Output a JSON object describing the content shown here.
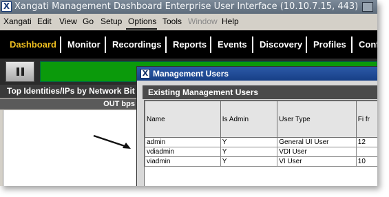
{
  "window": {
    "title": "Xangati Management Dashboard Enterprise User Interface (10.10.7.15, 443)",
    "app_icon": "X"
  },
  "menu": {
    "items": [
      {
        "label": "Xangati",
        "enabled": true
      },
      {
        "label": "Edit",
        "enabled": true
      },
      {
        "label": "View",
        "enabled": true
      },
      {
        "label": "Go",
        "enabled": true
      },
      {
        "label": "Setup",
        "enabled": true
      },
      {
        "label": "Options",
        "enabled": true,
        "highlighted": true
      },
      {
        "label": "Tools",
        "enabled": true
      },
      {
        "label": "Window",
        "enabled": false
      },
      {
        "label": "Help",
        "enabled": true
      }
    ]
  },
  "nav": {
    "tabs": [
      {
        "label": "Dashboard",
        "active": true
      },
      {
        "label": "Monitor"
      },
      {
        "label": "Recordings"
      },
      {
        "label": "Reports"
      },
      {
        "label": "Events"
      },
      {
        "label": "Discovery"
      },
      {
        "label": "Profiles"
      },
      {
        "label": "Confi"
      }
    ]
  },
  "toolbar": {
    "pause_icon": "pause-icon",
    "status_color": "#0b9a0b"
  },
  "panel": {
    "title": "Top Identities/IPs by Network Bit",
    "column": "OUT bps"
  },
  "dialog": {
    "title": "Management Users",
    "section_title": "Existing Management Users",
    "columns": [
      "Name",
      "Is Admin",
      "User Type",
      "Fi fr"
    ],
    "rows": [
      [
        "admin",
        "Y",
        "General UI User",
        "12"
      ],
      [
        "vdiadmin",
        "Y",
        "VDI User",
        ""
      ],
      [
        "viadmin",
        "Y",
        "VI User",
        "10"
      ]
    ]
  },
  "colors": {
    "nav_background": "#000000",
    "active_tab": "#f0c020",
    "dialog_titlebar": "#1f4a96"
  }
}
